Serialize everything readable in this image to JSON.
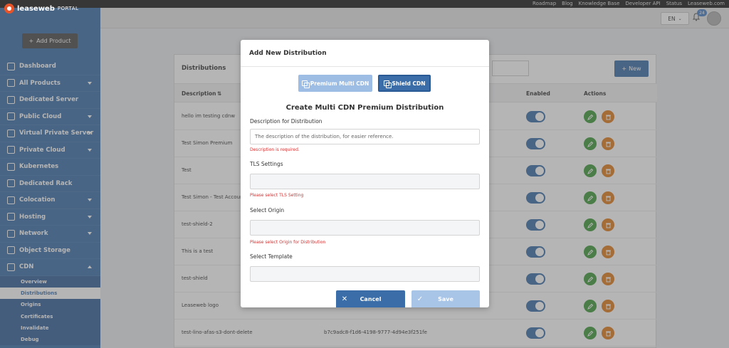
{
  "topbar": {
    "links": [
      "Roadmap",
      "Blog",
      "Knowledge Base",
      "Developer API",
      "Status",
      "Leaseweb.com"
    ]
  },
  "logo": {
    "brand": "leaseweb",
    "portal": "PORTAL"
  },
  "sidebar": {
    "add_product": "Add Product",
    "items": [
      {
        "label": "Dashboard",
        "icon": "dashboard-icon",
        "has_chevron": false
      },
      {
        "label": "All Products",
        "icon": "grid-icon",
        "has_chevron": true
      },
      {
        "label": "Dedicated Server",
        "icon": "server-icon",
        "has_chevron": false
      },
      {
        "label": "Public Cloud",
        "icon": "cloud-icon",
        "has_chevron": true
      },
      {
        "label": "Virtual Private Server",
        "icon": "cloud-icon",
        "has_chevron": true
      },
      {
        "label": "Private Cloud",
        "icon": "cloud-icon",
        "has_chevron": true
      },
      {
        "label": "Kubernetes",
        "icon": "kubernetes-icon",
        "has_chevron": false
      },
      {
        "label": "Dedicated Rack",
        "icon": "rack-icon",
        "has_chevron": false
      },
      {
        "label": "Colocation",
        "icon": "colocation-icon",
        "has_chevron": true
      },
      {
        "label": "Hosting",
        "icon": "globe-icon",
        "has_chevron": true
      },
      {
        "label": "Network",
        "icon": "network-icon",
        "has_chevron": true
      },
      {
        "label": "Object Storage",
        "icon": "storage-icon",
        "has_chevron": false
      },
      {
        "label": "CDN",
        "icon": "cdn-icon",
        "has_chevron": true
      }
    ],
    "cdn_sub": [
      "Overview",
      "Distributions",
      "Origins",
      "Certificates",
      "Invalidate",
      "Debug"
    ],
    "active_sub": "Distributions"
  },
  "header": {
    "lang": "EN",
    "notifications": "24"
  },
  "card": {
    "title": "Distributions",
    "new_label": "New",
    "columns": {
      "description": "Description",
      "enabled": "Enabled",
      "actions": "Actions"
    },
    "rows": [
      {
        "desc": "hello im testing cdnw",
        "uuid": ""
      },
      {
        "desc": "Test Simon Premium",
        "uuid": ""
      },
      {
        "desc": "Test",
        "uuid": ""
      },
      {
        "desc": "Test Simon - Test Account",
        "uuid": ""
      },
      {
        "desc": "test-shield-2",
        "uuid": ""
      },
      {
        "desc": "This is a test",
        "uuid": ""
      },
      {
        "desc": "test-shield",
        "uuid": ""
      },
      {
        "desc": "Leaseweb logo",
        "uuid": ""
      },
      {
        "desc": "test-lino-afas-s3-dont-delete",
        "uuid": "b7c9adc8-f1d6-4198-9777-4d94e3f251fe"
      }
    ]
  },
  "modal": {
    "title": "Add New Distribution",
    "tab_premium": "Premium Multi CDN",
    "tab_shield": "Shield CDN",
    "form_title": "Create Multi CDN Premium Distribution",
    "desc_label": "Description for Distribution",
    "desc_placeholder": "The description of the distribution, for easier reference.",
    "desc_error": "Description is required.",
    "tls_label": "TLS Settings",
    "tls_error": "Please select TLS Setting",
    "origin_label": "Select Origin",
    "origin_error": "Please select Origin for Distribution",
    "template_label": "Select Template",
    "cancel": "Cancel",
    "save": "Save"
  },
  "colors": {
    "primary": "#3b6ea8",
    "danger": "#d93030",
    "edit": "#3f9a3a",
    "delete": "#e07a1a"
  }
}
